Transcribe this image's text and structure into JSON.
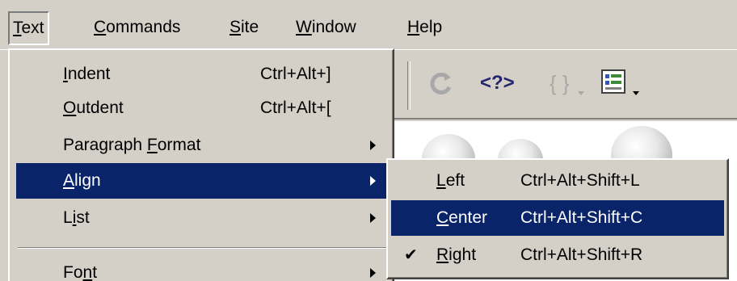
{
  "menubar": {
    "items": [
      {
        "mnemonic": "T",
        "rest": "ext"
      },
      {
        "mnemonic": "C",
        "rest": "ommands"
      },
      {
        "mnemonic": "S",
        "rest": "ite"
      },
      {
        "mnemonic": "W",
        "rest": "indow"
      },
      {
        "mnemonic": "H",
        "rest": "elp"
      }
    ]
  },
  "text_menu": {
    "items": [
      {
        "pre": "",
        "mnemonic": "I",
        "post": "ndent",
        "shortcut": "Ctrl+Alt+]"
      },
      {
        "pre": "",
        "mnemonic": "O",
        "post": "utdent",
        "shortcut": "Ctrl+Alt+["
      },
      {
        "pre": "Paragraph ",
        "mnemonic": "F",
        "post": "ormat",
        "shortcut": ""
      },
      {
        "pre": "",
        "mnemonic": "A",
        "post": "lign",
        "shortcut": ""
      },
      {
        "pre": "L",
        "mnemonic": "i",
        "post": "st",
        "shortcut": ""
      },
      {
        "pre": "Fo",
        "mnemonic": "n",
        "post": "t",
        "shortcut": ""
      }
    ]
  },
  "align_submenu": {
    "items": [
      {
        "mnemonic": "L",
        "rest": "eft",
        "shortcut": "Ctrl+Alt+Shift+L",
        "checked": false
      },
      {
        "mnemonic": "C",
        "rest": "enter",
        "shortcut": "Ctrl+Alt+Shift+C",
        "checked": false
      },
      {
        "mnemonic": "R",
        "rest": "ight",
        "shortcut": "Ctrl+Alt+Shift+R",
        "checked": true
      }
    ],
    "check_glyph": "✔"
  },
  "toolbar": {
    "icons": [
      "refresh-icon",
      "code-tag-icon",
      "braces-icon",
      "page-properties-icon"
    ],
    "code_tag_text": "<?>",
    "braces_text": "{ }"
  },
  "colors": {
    "face": "#d4d0c8",
    "highlight": "#0a246a",
    "highlight_text": "#ffffff"
  }
}
